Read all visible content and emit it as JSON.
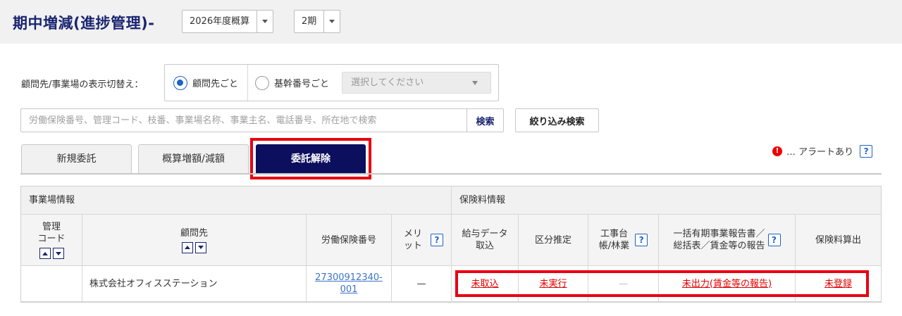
{
  "header": {
    "title": "期中増減(進捗管理)-",
    "fiscal_select": "2026年度概算",
    "period_select": "2期"
  },
  "display_switch": {
    "label": "顧問先/事業場の表示切替え：",
    "option_client": "顧問先ごと",
    "option_base": "基幹番号ごと",
    "select_placeholder": "選択してください",
    "selected": "顧問先ごと"
  },
  "search": {
    "placeholder": "労働保険番号、管理コード、枝番、事業場名称、事業主名、電話番号、所在地で検索",
    "button": "検索",
    "filter_button": "絞り込み検索"
  },
  "tabs": [
    {
      "label": "新規委託",
      "active": false
    },
    {
      "label": "概算増額/減額",
      "active": false
    },
    {
      "label": "委託解除",
      "active": true
    }
  ],
  "alert_legend": {
    "text": "… アラートあり",
    "icon": "!"
  },
  "table": {
    "group_headers": {
      "business": "事業場情報",
      "insurance": "保険料情報"
    },
    "headers": {
      "mgmt_code": "管理\nコード",
      "client": "顧問先",
      "insurance_no": "労働保険番号",
      "merit": "メリット",
      "salary": "給与データ\n取込",
      "category": "区分推定",
      "construction": "工事台\n帳/林業",
      "bulk_report": "一括有期事業報告書／\n総括表／賃金等の報告",
      "premium": "保険料算出"
    },
    "rows": [
      {
        "mgmt_code": "",
        "client": "株式会社オフィスステーション",
        "insurance_no": "27300912340-\n001",
        "merit": "—",
        "salary": "未取込",
        "category": "未実行",
        "construction": "—",
        "bulk_report": "未出力(賃金等の報告)",
        "premium": "未登録"
      }
    ]
  },
  "help_icon": "?",
  "colors": {
    "title": "#1a2470",
    "active_tab": "#0c0f5e",
    "highlight": "#e8000f",
    "link_blue": "#3b74c8",
    "link_red": "#e00000",
    "radio": "#1e62c8"
  }
}
